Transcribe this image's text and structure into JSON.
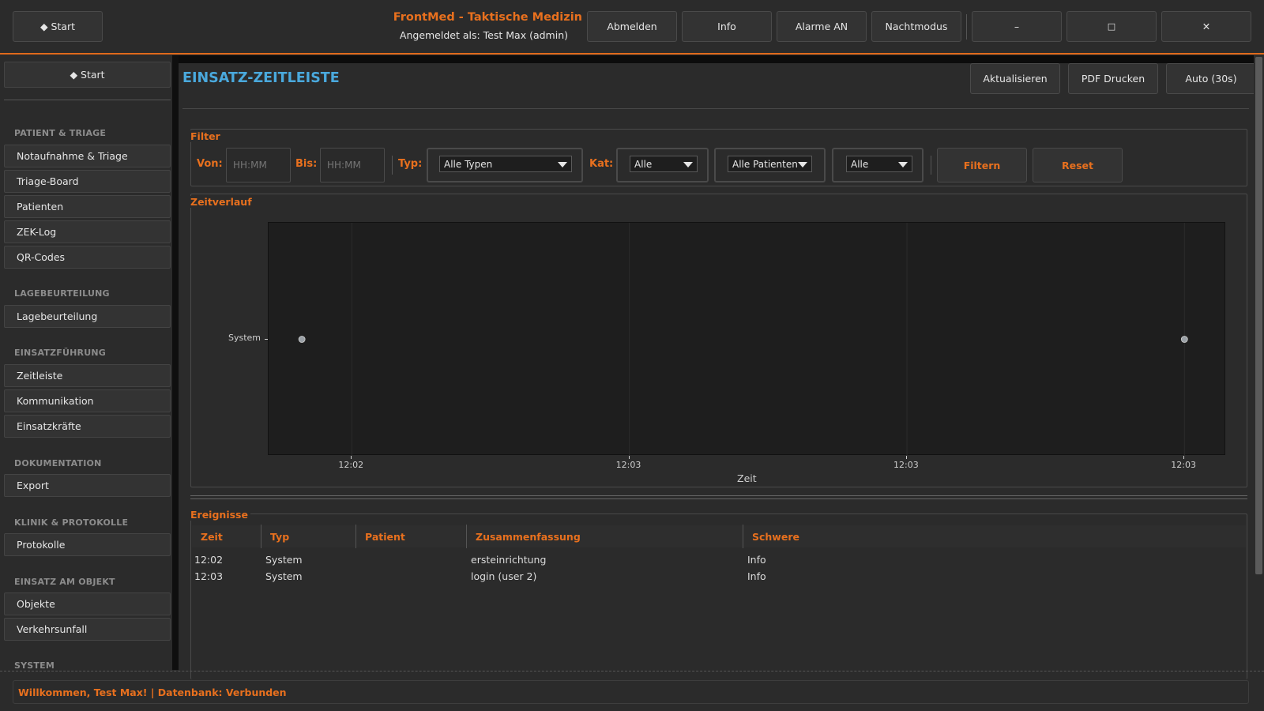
{
  "header": {
    "start_label": "◆  Start",
    "app_title": "FrontMed - Taktische Medizin",
    "user_line": "Angemeldet als: Test Max (admin)",
    "buttons": {
      "logout": "Abmelden",
      "info": "Info",
      "alarms": "Alarme AN",
      "night_mode": "Nachtmodus"
    },
    "window_controls": {
      "minimize": "–",
      "maximize": "□",
      "close": "✕"
    }
  },
  "sidebar": {
    "start_label": "◆  Start",
    "sections": [
      {
        "title": "PATIENT & TRIAGE",
        "items": [
          "Notaufnahme & Triage",
          "Triage-Board",
          "Patienten",
          "ZEK-Log",
          "QR-Codes"
        ]
      },
      {
        "title": "LAGEBEURTEILUNG",
        "items": [
          "Lagebeurteilung"
        ]
      },
      {
        "title": "EINSATZFÜHRUNG",
        "items": [
          "Zeitleiste",
          "Kommunikation",
          "Einsatzkräfte"
        ]
      },
      {
        "title": "DOKUMENTATION",
        "items": [
          "Export"
        ]
      },
      {
        "title": "KLINIK & PROTOKOLLE",
        "items": [
          "Protokolle"
        ]
      },
      {
        "title": "EINSATZ AM OBJEKT",
        "items": [
          "Objekte",
          "Verkehrsunfall"
        ]
      },
      {
        "title": "SYSTEM",
        "items": []
      }
    ]
  },
  "page": {
    "title": "EINSATZ-ZEITLEISTE",
    "actions": {
      "refresh": "Aktualisieren",
      "pdf": "PDF Drucken",
      "auto": "Auto (30s)"
    }
  },
  "filter": {
    "group_label": "Filter",
    "von_label": "Von:",
    "von_placeholder": "HH:MM",
    "bis_label": "Bis:",
    "bis_placeholder": "HH:MM",
    "typ_label": "Typ:",
    "typ_value": "Alle Typen",
    "kat_label": "Kat:",
    "kat_value": "Alle",
    "patient_value": "Alle Patienten",
    "extra_value": "Alle",
    "filter_button": "Filtern",
    "reset_button": "Reset"
  },
  "timeline": {
    "group_label": "Zeitverlauf",
    "chart_data": {
      "type": "scatter",
      "xlabel": "Zeit",
      "ylabel": "",
      "categories": [
        "System"
      ],
      "x_ticks": [
        "12:02",
        "12:03",
        "12:03",
        "12:03"
      ],
      "x_tick_values": [
        0.0,
        0.3333,
        0.6667,
        1.0
      ],
      "xlim": [
        -0.1,
        1.05
      ],
      "grid": true,
      "series": [
        {
          "category": "System",
          "points": [
            {
              "x": -0.06,
              "time": "12:02"
            },
            {
              "x": 1.0,
              "time": "12:03"
            }
          ]
        }
      ],
      "colors": {
        "point": "#9aa0a6",
        "plot_bg": "#1e1e1e",
        "grid": "#2c2c2c"
      }
    }
  },
  "events": {
    "group_label": "Ereignisse",
    "columns": [
      "Zeit",
      "Typ",
      "Patient",
      "Zusammenfassung",
      "Schwere"
    ],
    "rows": [
      [
        "12:02",
        "System",
        "",
        "ersteinrichtung",
        "Info"
      ],
      [
        "12:03",
        "System",
        "",
        "login (user 2)",
        "Info"
      ]
    ]
  },
  "status": {
    "text": "Willkommen, Test Max! | Datenbank: Verbunden"
  },
  "colors": {
    "accent": "#e8701e",
    "title_blue": "#4aa9dd",
    "background": "#2b2b2b"
  }
}
